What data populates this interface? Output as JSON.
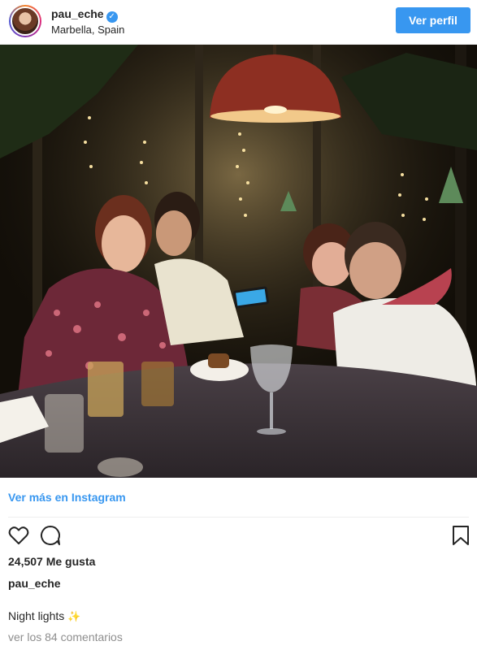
{
  "header": {
    "username": "pau_eche",
    "verified_icon": "verified-badge-icon",
    "location": "Marbella, Spain",
    "profile_button": "Ver perfil"
  },
  "photo": {
    "icon": "restaurant-night-photo"
  },
  "footer": {
    "more_link": "Ver más en Instagram",
    "likes": "24,507 Me gusta",
    "owner": "pau_eche",
    "caption": "Night lights",
    "caption_emoji": "✨",
    "comments": "ver los 84 comentarios"
  },
  "colors": {
    "accent": "#3897f0",
    "text": "#262626",
    "muted": "#8e8e8e"
  }
}
